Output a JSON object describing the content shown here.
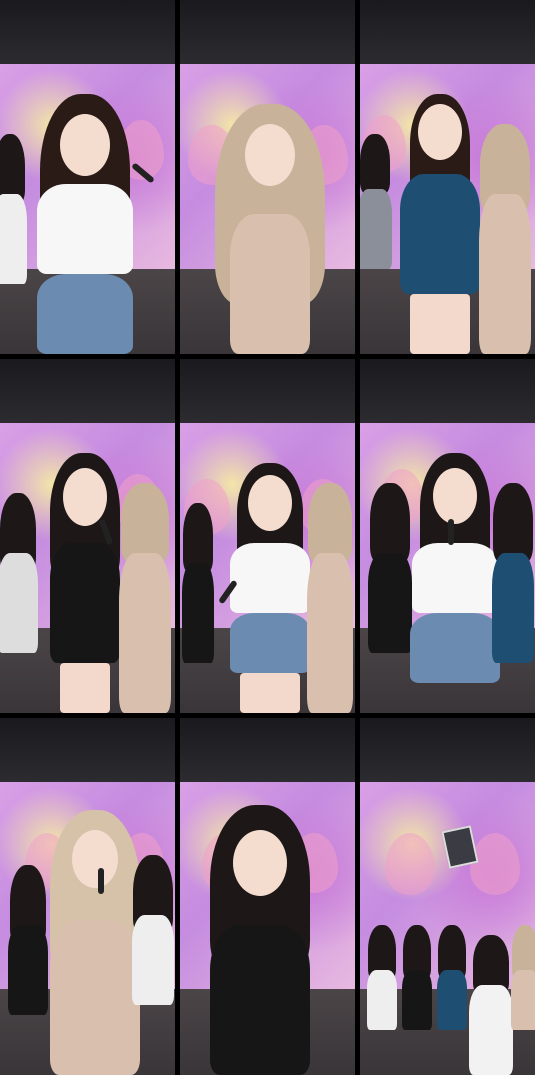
{
  "screen": {
    "description_label": "",
    "colors": {
      "background": "#000000",
      "backdrop_purple": "#c58ce0",
      "backdrop_yellow": "#f3e6a8",
      "floor": "#3a3538",
      "butterfly_pink": "#f0a0c8"
    }
  },
  "tiles": [
    {
      "id": "r1c1",
      "scene": "performer-white-top-denim"
    },
    {
      "id": "r1c2",
      "scene": "performer-champagne-dress"
    },
    {
      "id": "r1c3",
      "scene": "performer-blue-dress"
    },
    {
      "id": "r2c1",
      "scene": "performer-black-dress"
    },
    {
      "id": "r2c2",
      "scene": "performer-white-top-dancing"
    },
    {
      "id": "r2c3",
      "scene": "performer-white-top-laughing"
    },
    {
      "id": "r3c1",
      "scene": "performer-champagne-dress-mic"
    },
    {
      "id": "r3c2",
      "scene": "performer-black-dress-closeup"
    },
    {
      "id": "r3c3",
      "scene": "group-seated"
    }
  ]
}
